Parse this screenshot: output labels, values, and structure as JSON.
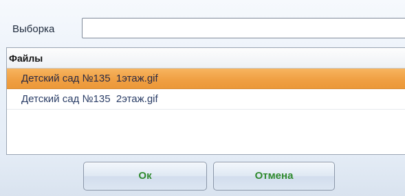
{
  "filter": {
    "label": "Выборка",
    "value": ""
  },
  "files": {
    "header": "Файлы",
    "items": [
      {
        "name": "Детский сад №135  1этаж.gif",
        "selected": true
      },
      {
        "name": "Детский сад №135  2этаж.gif",
        "selected": false
      }
    ]
  },
  "buttons": {
    "ok_label": "Ок",
    "cancel_label": "Отмена"
  },
  "colors": {
    "selection": "#f0a043",
    "button_text": "#2f8a2f"
  }
}
